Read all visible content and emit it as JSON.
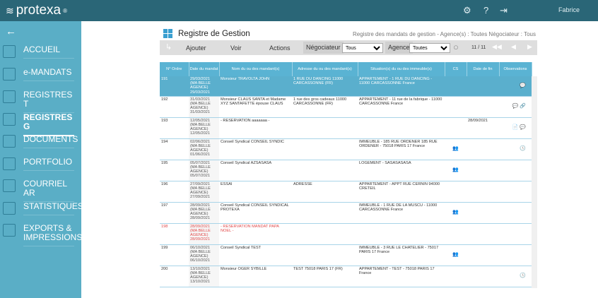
{
  "header": {
    "logo": "protexa",
    "logo_mark": "®",
    "user": "Fabrice"
  },
  "sidebar": {
    "items": [
      {
        "label": "ACCUEIL",
        "icon": "home-icon"
      },
      {
        "label": "e-MANDATS",
        "icon": "signature-icon"
      },
      {
        "label": "REGISTRES T",
        "icon": "register-t-icon"
      },
      {
        "label": "REGISTRES G",
        "icon": "register-g-icon",
        "active": true
      },
      {
        "label": "DOCUMENTS",
        "icon": "document-icon"
      },
      {
        "label": "PORTFOLIO",
        "icon": "folder-icon"
      },
      {
        "label": "COURRIEL AR",
        "icon": "envelope-icon"
      },
      {
        "label": "STATISTIQUES",
        "icon": "chart-icon"
      },
      {
        "label": "EXPORTS & IMPRESSIONS",
        "icon": "export-icon"
      }
    ]
  },
  "page": {
    "title": "Registre de Gestion",
    "crumb": "Registre des mandats de gestion - Agence(s) : Toutes Négociateur : Tous"
  },
  "toolbar": {
    "add": "Ajouter",
    "view": "Voir",
    "actions": "Actions",
    "negociateur_label": "Négociateur",
    "negociateur_value": "Tous",
    "agence_label": "Agence",
    "agence_value": "Toutes",
    "pager": "11 / 11"
  },
  "table": {
    "headers": [
      "N° Ordre",
      "Date du mandat",
      "Nom du ou des mandant(s)",
      "Adresse du ou des mandant(s)",
      "Situation(s) du ou des immeuble(s)",
      "CS",
      "Date de fin",
      "Observations"
    ],
    "rows": [
      {
        "no": "191",
        "date": "29/03/2021 (MA BELLE AGENCE) 29/03/2021",
        "nom": "Monsieur TRAVOLTA JOHN",
        "adresse": "1 RUE DU DANCING 11000 CARCASSONNE (FR)",
        "situation": "APPARTEMENT - 1 RUE DU DANCING - 11000 CARCASSONNE France",
        "cs": "",
        "fin": "",
        "obs": "💬"
      },
      {
        "no": "192",
        "date": "31/03/2021 (MA BELLE AGENCE) 31/03/2021",
        "nom": "Monsieur CLAUS SANTA et Madame XYZ SANTAFETTE épouse CLAUS",
        "adresse": "1 rue des gros cadeaux 11000 CARCASSONNE (FR)",
        "situation": "APPARTEMENT - 11 rue de la fabrique - 11000 CARCASSONNE France",
        "cs": "",
        "fin": "",
        "obs": "💬 🔗"
      },
      {
        "no": "193",
        "date": "12/05/2021 (MA BELLE AGENCE) 12/05/2021",
        "nom": "- RESERVATION aaaaaaa -",
        "adresse": "",
        "situation": "",
        "cs": "",
        "fin": "28/09/2021",
        "obs": "📄 💬"
      },
      {
        "no": "194",
        "date": "02/06/2021 (MA BELLE AGENCE) 01/06/2021",
        "nom": "Conseil Syndical CONSEIL SYNDIC",
        "adresse": "",
        "situation": "IMMEUBLE - 185 RUE ORDENER 185 RUE ORDENER - 75018 PARIS 17 France",
        "cs": "👥",
        "fin": "",
        "obs": "🕓"
      },
      {
        "no": "195",
        "date": "05/07/2021 (MA BELLE AGENCE) 05/07/2021",
        "nom": "Conseil Syndical AZSASASA",
        "adresse": "",
        "situation": "LOGEMENT - SASASASASA",
        "cs": "👥",
        "fin": "",
        "obs": ""
      },
      {
        "no": "196",
        "date": "27/09/2021 (MA BELLE AGENCE) 27/09/2021",
        "nom": "ESSAI",
        "adresse": "ADRESSE",
        "situation": "APPARTEMENT - APPT RUE CERNIN 94000 CRETEIL",
        "cs": "",
        "fin": "",
        "obs": ""
      },
      {
        "no": "197",
        "date": "28/09/2021 (MA BELLE AGENCE) 28/09/2021",
        "nom": "Conseil Syndical CONSEIL SYNDICAL PROTEXA",
        "adresse": "",
        "situation": "IMMEUBLE - 1 RUE DE LA MUSCU - 11000 CARCASSONNE France",
        "cs": "👥",
        "fin": "",
        "obs": ""
      },
      {
        "no": "198",
        "date": "28/09/2021 (MA BELLE AGENCE) 28/09/2021",
        "nom": "- RESERVATION MANDAT PAPA NOEL -",
        "adresse": "",
        "situation": "",
        "cs": "",
        "fin": "",
        "obs": "",
        "red": true
      },
      {
        "no": "199",
        "date": "06/10/2021 (MA BELLE AGENCE) 06/10/2021",
        "nom": "Conseil Syndical TEST",
        "adresse": "",
        "situation": "IMMEUBLE - 3 RUE LE CHATELIER - 75017 PARIS 17 France",
        "cs": "👥",
        "fin": "",
        "obs": ""
      },
      {
        "no": "200",
        "date": "13/10/2021 (MA BELLE AGENCE) 13/10/2021",
        "nom": "Monsieur OGER SYBILLE",
        "adresse": "TEST 75018 PARIS 17 (FR)",
        "situation": "APPARTEMENT - TEST - 75018 PARIS 17 France",
        "cs": "",
        "fin": "",
        "obs": "🕓"
      }
    ]
  }
}
